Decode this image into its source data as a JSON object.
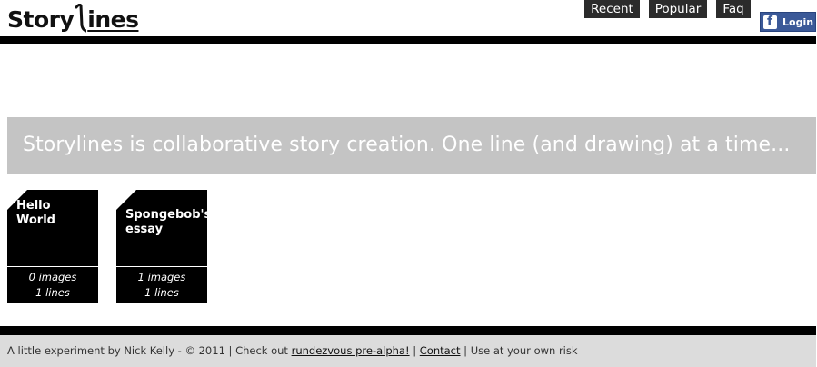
{
  "header": {
    "logo_left": "Story",
    "logo_right": "ines",
    "nav": [
      {
        "label": "Recent"
      },
      {
        "label": "Popular"
      },
      {
        "label": "Faq"
      }
    ],
    "login_label": "Login"
  },
  "banner": {
    "text": "Storylines is collaborative story creation. One line (and drawing) at a time..."
  },
  "stories": [
    {
      "title": "Hello World",
      "images": "0 images",
      "lines": "1 lines"
    },
    {
      "title": "Spongebob's essay",
      "images": "1 images",
      "lines": "1 lines"
    }
  ],
  "footer": {
    "prefix": "A little experiment by Nick Kelly - © 2011 | Check out ",
    "link1": "rundezvous pre-alpha!",
    "sep": " | ",
    "link2": "Contact",
    "suffix": " | Use at your own risk"
  },
  "colors": {
    "banner_bg": "#c4c4c4",
    "nav_bg": "#2b2b2b",
    "facebook_blue": "#3b5998",
    "footer_bg": "#dcdcdc"
  }
}
